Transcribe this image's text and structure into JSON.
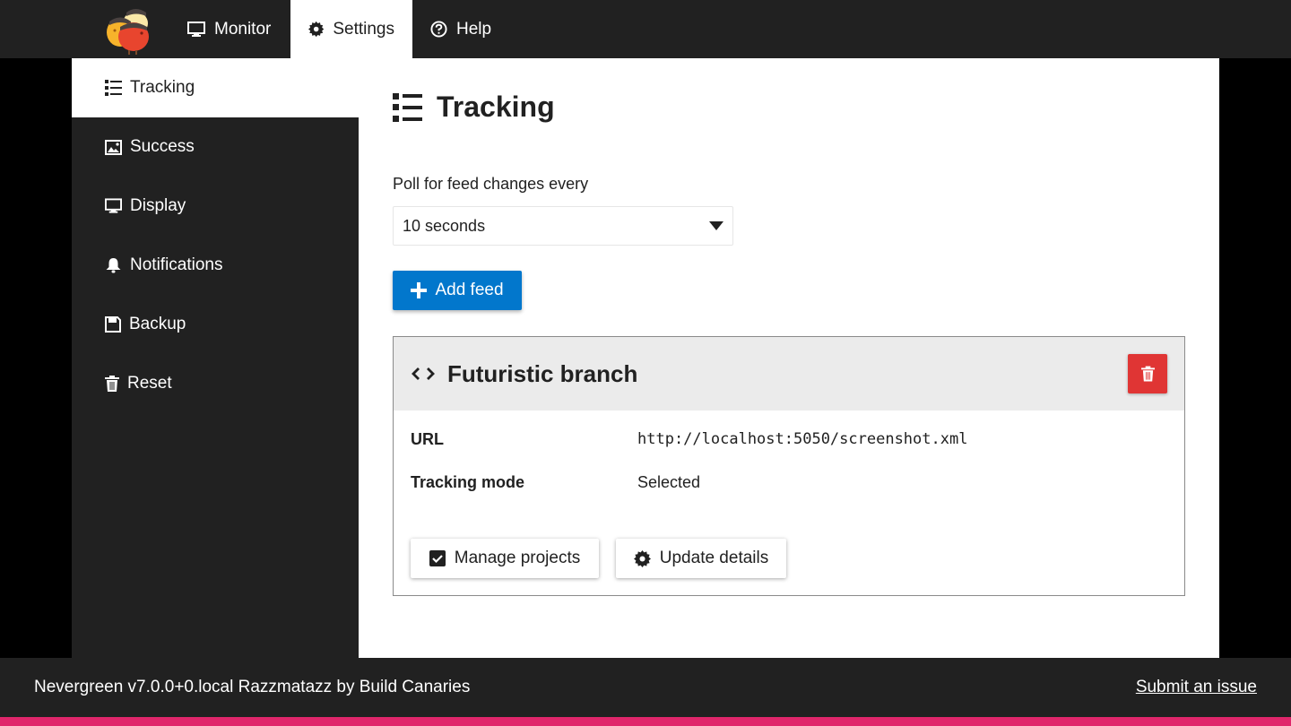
{
  "header": {
    "logo_alt": "Nevergreen logo",
    "tabs": [
      {
        "label": "Monitor",
        "icon": "monitor-icon",
        "active": false
      },
      {
        "label": "Settings",
        "icon": "gear-icon",
        "active": true
      },
      {
        "label": "Help",
        "icon": "help-icon",
        "active": false
      }
    ]
  },
  "sidebar": {
    "items": [
      {
        "label": "Tracking",
        "icon": "list-icon",
        "active": true
      },
      {
        "label": "Success",
        "icon": "image-icon",
        "active": false
      },
      {
        "label": "Display",
        "icon": "monitor-icon",
        "active": false
      },
      {
        "label": "Notifications",
        "icon": "bell-icon",
        "active": false
      },
      {
        "label": "Backup",
        "icon": "floppy-icon",
        "active": false
      },
      {
        "label": "Reset",
        "icon": "trash-icon",
        "active": false
      }
    ]
  },
  "main": {
    "title": "Tracking",
    "poll_label": "Poll for feed changes every",
    "poll_value": "10 seconds",
    "add_feed_label": "Add feed",
    "feed": {
      "title": "Futuristic branch",
      "url_label": "URL",
      "url_value": "http://localhost:5050/screenshot.xml",
      "mode_label": "Tracking mode",
      "mode_value": "Selected",
      "manage_label": "Manage projects",
      "update_label": "Update details"
    }
  },
  "footer": {
    "version_text": "Nevergreen v7.0.0+0.local Razzmatazz by Build Canaries",
    "link_label": "Submit an issue"
  },
  "colors": {
    "primary": "#0277cc",
    "danger": "#e03534",
    "accent": "#e0266b",
    "dark": "#212121"
  }
}
